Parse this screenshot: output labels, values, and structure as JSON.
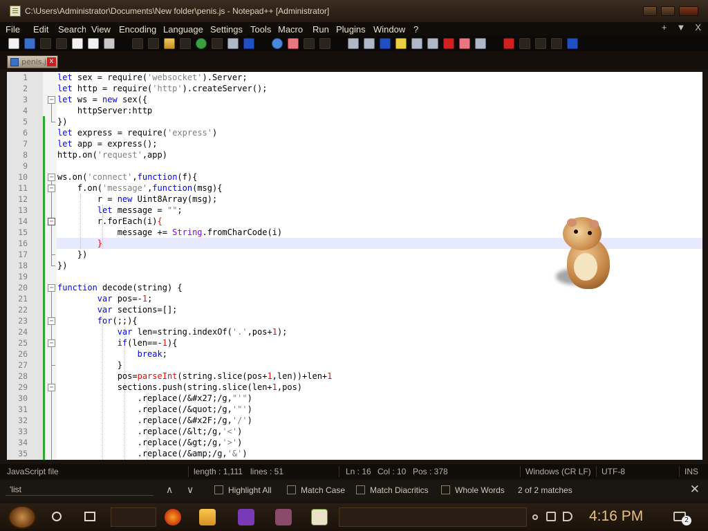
{
  "window": {
    "title": "C:\\Users\\Administrator\\Documents\\New folder\\penis.js - Notepad++ [Administrator]"
  },
  "menu": {
    "items": [
      "File",
      "Edit",
      "Search",
      "View",
      "Encoding",
      "Language",
      "Settings",
      "Tools",
      "Macro",
      "Run",
      "Plugins",
      "Window",
      "?"
    ],
    "right_plus": "+",
    "right_arrow": "▼",
    "right_close": "X"
  },
  "tab": {
    "label": "penis.js",
    "close_glyph": "x"
  },
  "editor": {
    "lines": [
      {
        "n": "1",
        "html": "<span class=\"kw\">let</span> sex = require(<span class=\"st\">'websocket'</span>).Server;"
      },
      {
        "n": "2",
        "html": "<span class=\"kw\">let</span> http = require(<span class=\"st\">'http'</span>).createServer();"
      },
      {
        "n": "3",
        "html": "<span class=\"kw\">let</span> ws = <span class=\"kw\">new</span> sex({"
      },
      {
        "n": "4",
        "html": "    httpServer:http"
      },
      {
        "n": "5",
        "html": "})"
      },
      {
        "n": "6",
        "html": "<span class=\"kw\">let</span> express = require(<span class=\"st\">'express'</span>)"
      },
      {
        "n": "7",
        "html": "<span class=\"kw\">let</span> app = express();"
      },
      {
        "n": "8",
        "html": "http.on(<span class=\"st\">'request'</span>,app)"
      },
      {
        "n": "9",
        "html": ""
      },
      {
        "n": "10",
        "html": "ws.on(<span class=\"st\">'connect'</span>,<span class=\"kw\">function</span>(f){"
      },
      {
        "n": "11",
        "html": "    f.on(<span class=\"st\">'message'</span>,<span class=\"kw\">function</span>(msg){"
      },
      {
        "n": "12",
        "html": "        r = <span class=\"kw\">new</span> Uint8Array(msg);"
      },
      {
        "n": "13",
        "html": "        <span class=\"kw\">let</span> message = <span class=\"st\">\"\"</span>;"
      },
      {
        "n": "14",
        "html": "        r.forEach(i)<span class=\"br\">{</span>"
      },
      {
        "n": "15",
        "html": "            message += <span class=\"fn\">String</span>.fromCharCode(i)"
      },
      {
        "n": "16",
        "html": "        <span class=\"br\">}</span>"
      },
      {
        "n": "17",
        "html": "    })"
      },
      {
        "n": "18",
        "html": "})"
      },
      {
        "n": "19",
        "html": ""
      },
      {
        "n": "20",
        "html": "<span class=\"kw\">function</span> decode(string) {"
      },
      {
        "n": "21",
        "html": "        <span class=\"kw\">var</span> pos=-<span class=\"nm\">1</span>;"
      },
      {
        "n": "22",
        "html": "        <span class=\"kw\">var</span> sections=[];"
      },
      {
        "n": "23",
        "html": "        <span class=\"kw\">for</span>(;;){"
      },
      {
        "n": "24",
        "html": "            <span class=\"kw\">var</span> len=string.indexOf(<span class=\"st\">'.'</span>,pos+<span class=\"nm\">1</span>);"
      },
      {
        "n": "25",
        "html": "            <span class=\"kw\">if</span>(len==-<span class=\"nm\">1</span>){"
      },
      {
        "n": "26",
        "html": "                <span class=\"kw\">break</span>;"
      },
      {
        "n": "27",
        "html": "            }"
      },
      {
        "n": "28",
        "html": "            pos=<span class=\"br\">parseInt</span>(string.slice(pos+<span class=\"nm\">1</span>,len))+len+<span class=\"nm\">1</span>"
      },
      {
        "n": "29",
        "html": "            sections.push(string.slice(len+<span class=\"nm\">1</span>,pos)"
      },
      {
        "n": "30",
        "html": "                .replace(/&amp;#x27;/g,<span class=\"st\">\"'\"</span>)"
      },
      {
        "n": "31",
        "html": "                .replace(/&amp;quot;/g,<span class=\"st\">'\"'</span>)"
      },
      {
        "n": "32",
        "html": "                .replace(/&amp;#x2F;/g,<span class=\"st\">'/'</span>)"
      },
      {
        "n": "33",
        "html": "                .replace(/&amp;lt;/g,<span class=\"st\">'&lt;'</span>)"
      },
      {
        "n": "34",
        "html": "                .replace(/&amp;gt;/g,<span class=\"st\">'&gt;'</span>)"
      },
      {
        "n": "35",
        "html": "                .replace(/&amp;amp;/g,<span class=\"st\">'&amp;'</span>)"
      }
    ]
  },
  "statusbar": {
    "file_type": "JavaScript file",
    "length": "length : 1,111",
    "lines": "lines : 51",
    "ln": "Ln : 16",
    "col": "Col : 10",
    "pos": "Pos : 378",
    "eol": "Windows (CR LF)",
    "encoding": "UTF-8",
    "mode": "INS"
  },
  "findbar": {
    "query": "'list",
    "up": "∧",
    "down": "∨",
    "highlight_all": "Highlight All",
    "match_case": "Match Case",
    "match_diacritics": "Match Diacritics",
    "whole_words": "Whole Words",
    "result": "2 of 2 matches",
    "close": "✕"
  },
  "taskbar": {
    "time": "4:16 PM",
    "notification_count": "2"
  },
  "colors": {
    "keyword": "#0000ff",
    "string": "#808080",
    "number": "#ff0000",
    "changebar": "#2fa830",
    "clock": "#e8c080"
  }
}
